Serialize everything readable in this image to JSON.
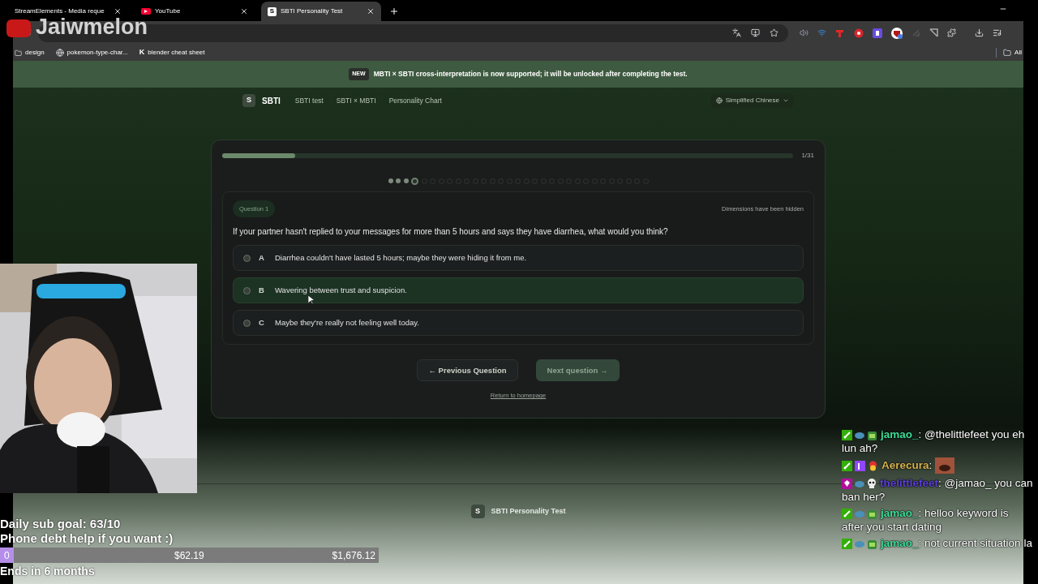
{
  "browser": {
    "tabs": [
      {
        "title": "StreamElements - Media reque",
        "kind": "blank",
        "selected": false
      },
      {
        "title": "YouTube",
        "kind": "youtube",
        "selected": false
      },
      {
        "title": "SBTI Personality Test",
        "kind": "letter",
        "icon_text": "S",
        "selected": true
      }
    ],
    "bookmarks": [
      {
        "label": "design",
        "kind": "folder"
      },
      {
        "label": "pokemon-type-char...",
        "kind": "globe"
      },
      {
        "label": "blender cheat sheet",
        "kind": "letter",
        "icon_text": "K"
      }
    ],
    "all_bookmarks": "All"
  },
  "stream_title": "Jaiwmelon",
  "banner": {
    "badge": "NEW",
    "text": "MBTI × SBTI cross-interpretation is now supported; it will be unlocked after completing the test."
  },
  "nav": {
    "logo_letter": "S",
    "logo_text": "SBTI",
    "links": [
      "SBTI test",
      "SBTI × MBTI",
      "Personality Chart"
    ],
    "language": "Simplified Chinese"
  },
  "quiz": {
    "progress": {
      "level": 0.128,
      "counter": "1/31"
    },
    "steps": [
      {
        "done": true,
        "current": false
      },
      {
        "done": true,
        "current": false
      },
      {
        "done": true,
        "current": false
      },
      {
        "done": false,
        "current": true
      },
      {
        "done": false,
        "current": false
      },
      {
        "done": false,
        "current": false
      },
      {
        "done": false,
        "current": false
      },
      {
        "done": false,
        "current": false
      },
      {
        "done": false,
        "current": false
      },
      {
        "done": false,
        "current": false
      },
      {
        "done": false,
        "current": false
      },
      {
        "done": false,
        "current": false
      },
      {
        "done": false,
        "current": false
      },
      {
        "done": false,
        "current": false
      },
      {
        "done": false,
        "current": false
      },
      {
        "done": false,
        "current": false
      },
      {
        "done": false,
        "current": false
      },
      {
        "done": false,
        "current": false
      },
      {
        "done": false,
        "current": false
      },
      {
        "done": false,
        "current": false
      },
      {
        "done": false,
        "current": false
      },
      {
        "done": false,
        "current": false
      },
      {
        "done": false,
        "current": false
      },
      {
        "done": false,
        "current": false
      },
      {
        "done": false,
        "current": false
      },
      {
        "done": false,
        "current": false
      },
      {
        "done": false,
        "current": false
      },
      {
        "done": false,
        "current": false
      },
      {
        "done": false,
        "current": false
      },
      {
        "done": false,
        "current": false
      },
      {
        "done": false,
        "current": false
      }
    ],
    "question_label": "Question 1",
    "dimensions_note": "Dimensions have been hidden",
    "question": "If your partner hasn't replied to your messages for more than 5 hours and says they have diarrhea, what would you think?",
    "options": [
      {
        "letter": "A",
        "text": "Diarrhea couldn't have lasted 5 hours; maybe they were hiding it from me.",
        "selected": false,
        "hovered": false
      },
      {
        "letter": "B",
        "text": "Wavering between trust and suspicion.",
        "selected": false,
        "hovered": true
      },
      {
        "letter": "C",
        "text": "Maybe they're really not feeling well today.",
        "selected": false,
        "hovered": false
      }
    ],
    "previous": {
      "label": "← Previous Question",
      "disabled": false
    },
    "next": {
      "label": "Next question →",
      "disabled": true
    },
    "home_link": "Return to homepage"
  },
  "footer": {
    "logo_letter": "S",
    "title": "SBTI Personality Test"
  },
  "goal": {
    "lines": [
      "Daily sub goal: 63/10",
      "Phone debt help if you want :)"
    ],
    "level": 0.037,
    "start": "0",
    "current": "$62.19",
    "target": "$1,676.12",
    "ends": "Ends in 6 months"
  },
  "chat": [
    {
      "user": "jamao_",
      "separator": ":",
      "color": "#3ddc97",
      "badges": [
        {
          "kind": "mod"
        },
        {
          "kind": "cloud"
        },
        {
          "kind": "avatar"
        }
      ],
      "kind": "text",
      "text": "@thelittlefeet you eh lun ah?"
    },
    {
      "user": "Aerecura",
      "separator": ":",
      "color": "#d4b24c",
      "badges": [
        {
          "kind": "mod"
        },
        {
          "kind": "sub"
        },
        {
          "kind": "flower"
        }
      ],
      "kind": "emote"
    },
    {
      "user": "thelittlefeet",
      "separator": ":",
      "color": "#5b3fd6",
      "badges": [
        {
          "kind": "gem"
        },
        {
          "kind": "cloud"
        },
        {
          "kind": "skull"
        }
      ],
      "kind": "text",
      "text": "@jamao_ you can ban her?"
    },
    {
      "user": "jamao_",
      "separator": ":",
      "color": "#3ddc97",
      "badges": [
        {
          "kind": "mod"
        },
        {
          "kind": "cloud"
        },
        {
          "kind": "avatar"
        }
      ],
      "kind": "text",
      "text": "helloo keyword is after you start dating"
    },
    {
      "user": "jamao_",
      "separator": ":",
      "color": "#3ddc97",
      "badges": [
        {
          "kind": "mod"
        },
        {
          "kind": "cloud"
        },
        {
          "kind": "avatar"
        }
      ],
      "kind": "text",
      "text": "not current situation la"
    }
  ]
}
